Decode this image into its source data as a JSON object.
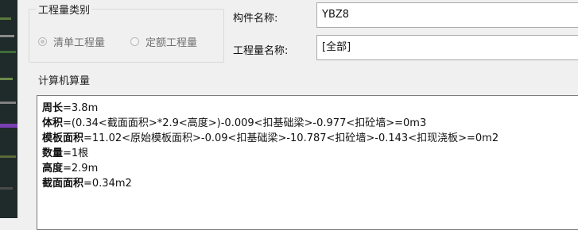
{
  "quantity_category": {
    "title": "工程量类别",
    "options": [
      {
        "label": "清单工程量",
        "selected": true
      },
      {
        "label": "定额工程量",
        "selected": false
      }
    ]
  },
  "fields": {
    "component_name_label": "构件名称:",
    "component_name_value": "YBZ8",
    "quantity_name_label": "工程量名称:",
    "quantity_name_value": "[全部]"
  },
  "calc": {
    "title": "计算机算量",
    "lines": [
      {
        "key": "周长",
        "expr": "=3.8m"
      },
      {
        "key": "体积",
        "expr": "=(0.34<截面面积>*2.9<高度>)-0.009<扣基础梁>-0.977<扣砼墙>=0m3"
      },
      {
        "key": "模板面积",
        "expr": "=11.02<原始模板面积>-0.09<扣基础梁>-10.787<扣砼墙>-0.143<扣现浇板>=0m2"
      },
      {
        "key": "数量",
        "expr": "=1根"
      },
      {
        "key": "高度",
        "expr": "=2.9m"
      },
      {
        "key": "截面面积",
        "expr": "=0.34m2"
      }
    ]
  }
}
